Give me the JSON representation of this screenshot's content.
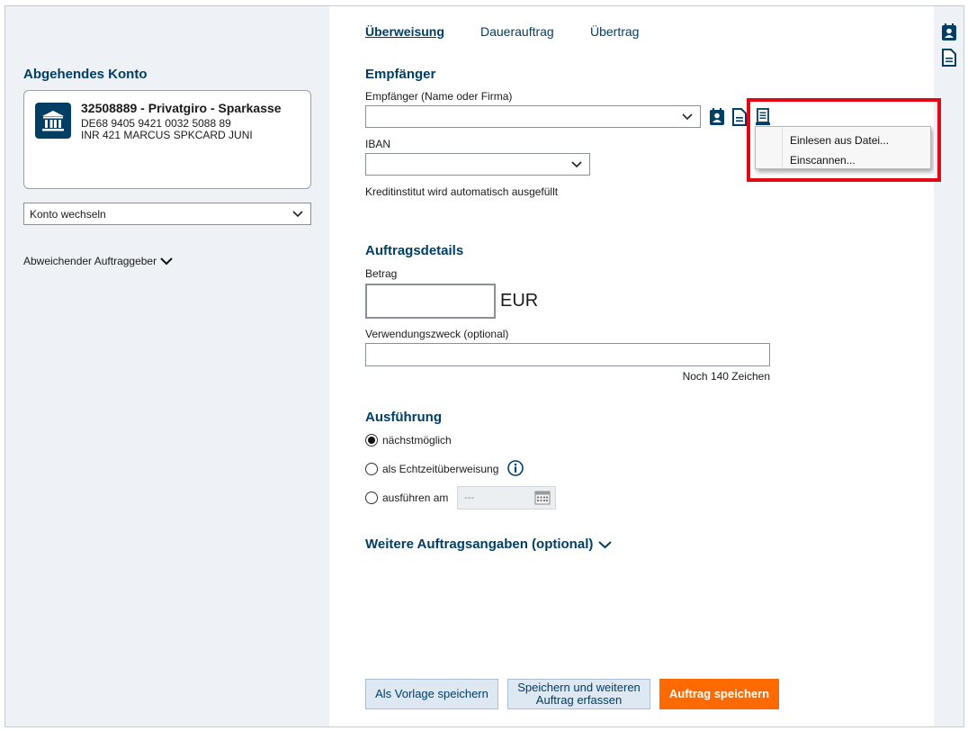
{
  "left": {
    "section_title": "Abgehendes Konto",
    "account": {
      "name": "32508889 - Privatgiro - Sparkasse",
      "iban": "DE68 9405 9421 0032 5088 89",
      "detail": "INR 421 MARCUS SPKCARD JUNI"
    },
    "switch_account": "Konto wechseln",
    "other_payer": "Abweichender Auftraggeber"
  },
  "tabs": [
    {
      "label": "Überweisung",
      "active": true
    },
    {
      "label": "Dauerauftrag",
      "active": false
    },
    {
      "label": "Übertrag",
      "active": false
    }
  ],
  "recipient": {
    "section_title": "Empfänger",
    "name_label": "Empfänger (Name oder Firma)",
    "name_value": "",
    "iban_label": "IBAN",
    "iban_value": "",
    "bank_hint": "Kreditinstitut wird automatisch ausgefüllt",
    "icons": [
      "address-book-icon",
      "document-icon",
      "scan-receipt-icon"
    ]
  },
  "context_menu": {
    "items": [
      "Einlesen aus Datei...",
      "Einscannen..."
    ]
  },
  "order_details": {
    "section_title": "Auftragsdetails",
    "amount_label": "Betrag",
    "amount_value": "",
    "currency": "EUR",
    "purpose_label": "Verwendungszweck (optional)",
    "purpose_value": "",
    "chars_left": "Noch 140 Zeichen"
  },
  "execution": {
    "section_title": "Ausführung",
    "options": [
      {
        "label": "nächstmöglich",
        "checked": true
      },
      {
        "label": "als Echtzeitüberweisung",
        "checked": false
      },
      {
        "label": "ausführen am",
        "checked": false
      }
    ],
    "date_placeholder": "---"
  },
  "more_details": "Weitere Auftragsangaben (optional)",
  "buttons": {
    "save_template": "Als Vorlage speichern",
    "save_and_new_line1": "Speichern und weiteren",
    "save_and_new_line2": "Auftrag erfassen",
    "save_order": "Auftrag speichern"
  },
  "colors": {
    "brand": "#003e63",
    "accent": "#ff6a00",
    "highlight": "#e30613"
  }
}
